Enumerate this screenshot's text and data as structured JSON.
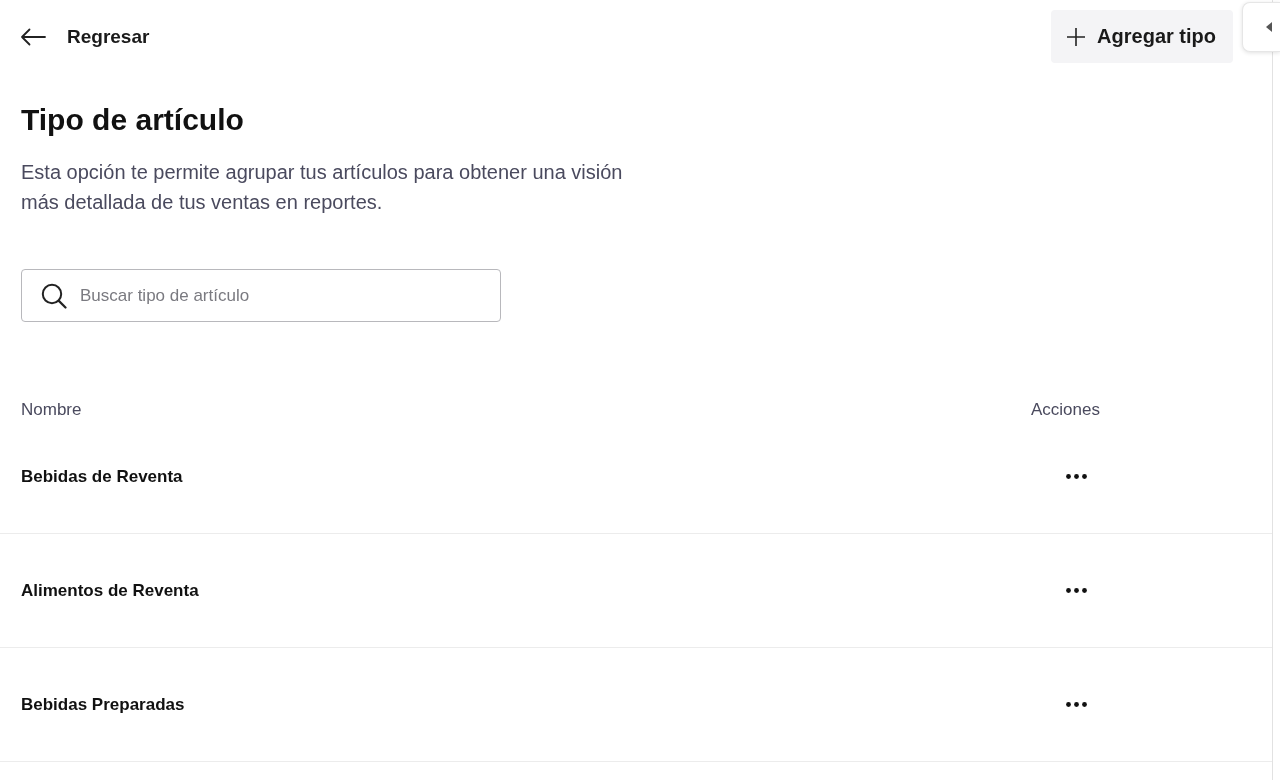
{
  "header": {
    "back_label": "Regresar",
    "add_button": "Agregar tipo"
  },
  "page": {
    "title": "Tipo de artículo",
    "description": "Esta opción te permite agrupar tus artículos para obtener una visión más detallada de tus ventas en reportes."
  },
  "search": {
    "placeholder": "Buscar tipo de artículo"
  },
  "table": {
    "columns": [
      "Nombre",
      "Acciones"
    ],
    "rows": [
      {
        "name": "Bebidas de Reventa"
      },
      {
        "name": "Alimentos de Reventa"
      },
      {
        "name": "Bebidas Preparadas"
      }
    ]
  }
}
